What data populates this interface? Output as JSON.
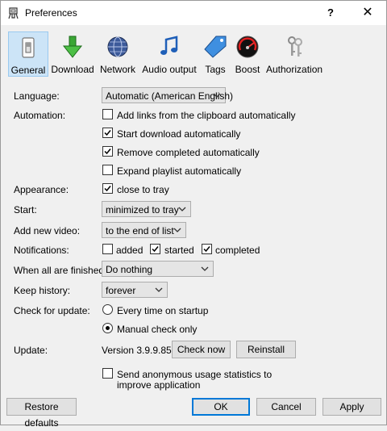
{
  "window": {
    "title": "Preferences",
    "help_glyph": "?",
    "close_glyph": "✕"
  },
  "toolbar": {
    "items": [
      {
        "label": "General",
        "icon": "general-switch-icon",
        "selected": true
      },
      {
        "label": "Download",
        "icon": "download-arrow-icon",
        "selected": false
      },
      {
        "label": "Network",
        "icon": "globe-icon",
        "selected": false
      },
      {
        "label": "Audio output",
        "icon": "music-note-icon",
        "selected": false
      },
      {
        "label": "Tags",
        "icon": "tag-icon",
        "selected": false
      },
      {
        "label": "Boost",
        "icon": "speedometer-icon",
        "selected": false
      },
      {
        "label": "Authorization",
        "icon": "keys-icon",
        "selected": false
      }
    ]
  },
  "form": {
    "language": {
      "label": "Language:",
      "value": "Automatic (American English)"
    },
    "automation": {
      "label": "Automation:",
      "options": [
        {
          "label": "Add links from the clipboard automatically",
          "checked": false
        },
        {
          "label": "Start download automatically",
          "checked": true
        },
        {
          "label": "Remove completed automatically",
          "checked": true
        },
        {
          "label": "Expand playlist automatically",
          "checked": false
        }
      ]
    },
    "appearance": {
      "label": "Appearance:",
      "option": {
        "label": "close to tray",
        "checked": true
      }
    },
    "start": {
      "label": "Start:",
      "value": "minimized to tray"
    },
    "add_new_video": {
      "label": "Add new video:",
      "value": "to the end of list"
    },
    "notifications": {
      "label": "Notifications:",
      "options": [
        {
          "label": "added",
          "checked": false
        },
        {
          "label": "started",
          "checked": true
        },
        {
          "label": "completed",
          "checked": true
        }
      ]
    },
    "when_finished": {
      "label": "When all are finished:",
      "value": "Do nothing"
    },
    "keep_history": {
      "label": "Keep history:",
      "value": "forever"
    },
    "check_update": {
      "label": "Check for update:",
      "options": [
        {
          "label": "Every time on startup",
          "selected": false
        },
        {
          "label": "Manual check only",
          "selected": true
        }
      ]
    },
    "update": {
      "label": "Update:",
      "version": "Version 3.9.9.85",
      "check_now": "Check now",
      "reinstall": "Reinstall"
    },
    "anonymous_stats": {
      "line1": "Send anonymous usage statistics to",
      "line2": "improve application",
      "checked": false
    }
  },
  "footer": {
    "restore": "Restore defaults",
    "ok": "OK",
    "cancel": "Cancel",
    "apply": "Apply"
  },
  "colors": {
    "accent": "#0078d7",
    "selected_bg": "#cce4f7",
    "window_bg": "#f0f0f0"
  }
}
